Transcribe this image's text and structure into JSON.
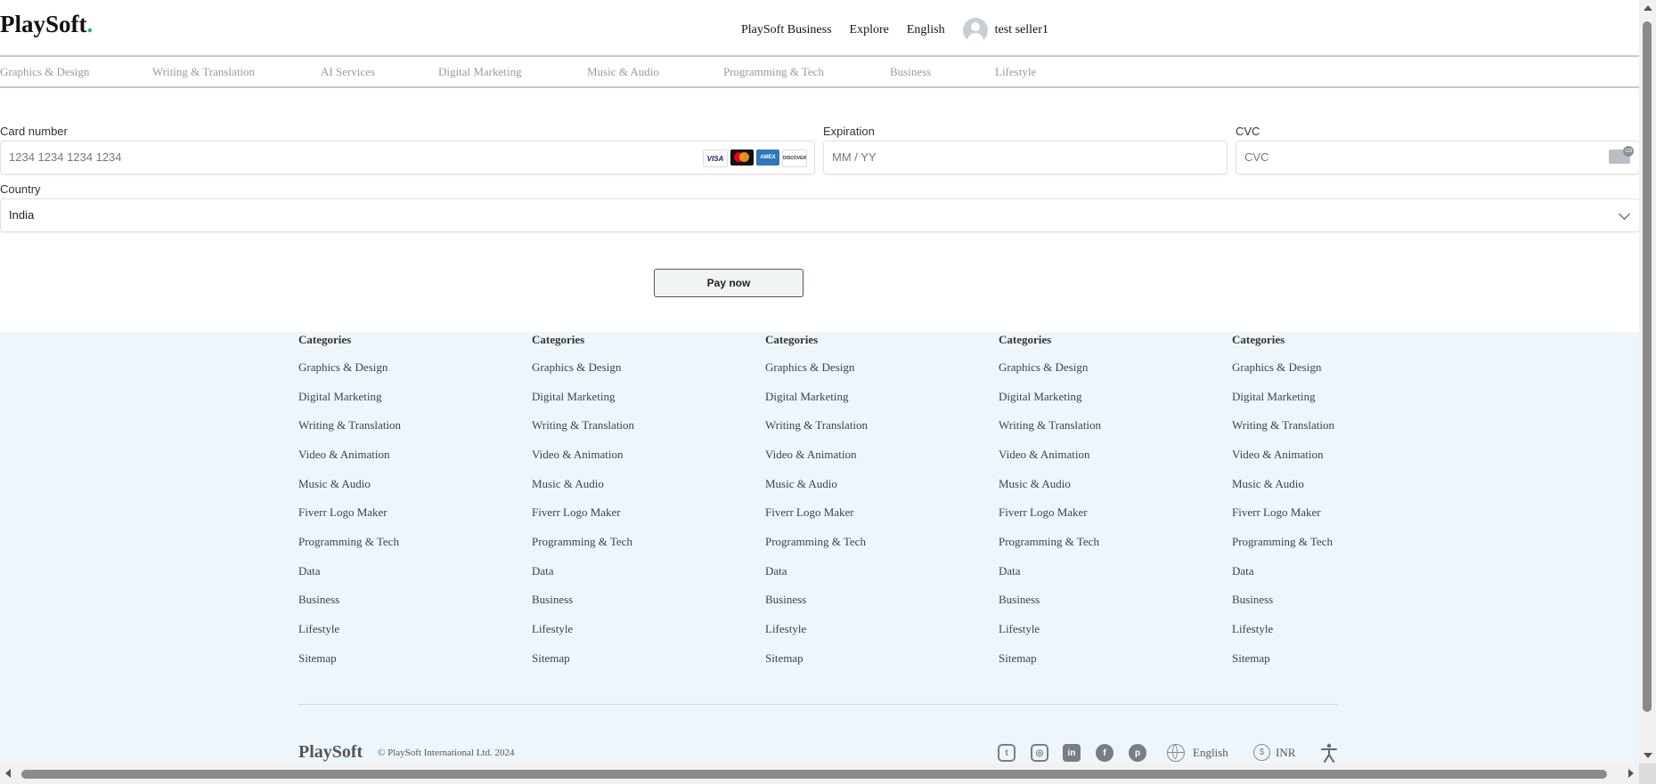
{
  "header": {
    "logo": "PlaySoft",
    "logo_dot": ".",
    "nav": {
      "business": "PlaySoft Business",
      "explore": "Explore",
      "language": "English",
      "username": "test seller1"
    },
    "categories": [
      "Graphics & Design",
      "Writing & Translation",
      "AI Services",
      "Digital Marketing",
      "Music & Audio",
      "Programming & Tech",
      "Business",
      "Lifestyle"
    ]
  },
  "payment": {
    "card_number_label": "Card number",
    "card_number_placeholder": "1234 1234 1234 1234",
    "card_brands": [
      "VISA",
      "Mastercard",
      "AMEX",
      "DISCOVER"
    ],
    "expiration_label": "Expiration",
    "expiration_placeholder": "MM / YY",
    "cvc_label": "CVC",
    "cvc_placeholder": "CVC",
    "country_label": "Country",
    "country_value": "India",
    "pay_button": "Pay now"
  },
  "footer": {
    "columns": [
      {
        "title": "Categories",
        "links": [
          "Graphics & Design",
          "Digital Marketing",
          "Writing & Translation",
          "Video & Animation",
          "Music & Audio",
          "Fiverr Logo Maker",
          "Programming & Tech",
          "Data",
          "Business",
          "Lifestyle",
          "Sitemap"
        ]
      },
      {
        "title": "Categories",
        "links": [
          "Graphics & Design",
          "Digital Marketing",
          "Writing & Translation",
          "Video & Animation",
          "Music & Audio",
          "Fiverr Logo Maker",
          "Programming & Tech",
          "Data",
          "Business",
          "Lifestyle",
          "Sitemap"
        ]
      },
      {
        "title": "Categories",
        "links": [
          "Graphics & Design",
          "Digital Marketing",
          "Writing & Translation",
          "Video & Animation",
          "Music & Audio",
          "Fiverr Logo Maker",
          "Programming & Tech",
          "Data",
          "Business",
          "Lifestyle",
          "Sitemap"
        ]
      },
      {
        "title": "Categories",
        "links": [
          "Graphics & Design",
          "Digital Marketing",
          "Writing & Translation",
          "Video & Animation",
          "Music & Audio",
          "Fiverr Logo Maker",
          "Programming & Tech",
          "Data",
          "Business",
          "Lifestyle",
          "Sitemap"
        ]
      },
      {
        "title": "Categories",
        "links": [
          "Graphics & Design",
          "Digital Marketing",
          "Writing & Translation",
          "Video & Animation",
          "Music & Audio",
          "Fiverr Logo Maker",
          "Programming & Tech",
          "Data",
          "Business",
          "Lifestyle",
          "Sitemap"
        ]
      }
    ],
    "brand": "PlaySoft",
    "copyright": "© PlaySoft International Ltd. 2024",
    "social_icons": [
      "twitter-icon",
      "instagram-icon",
      "linkedin-icon",
      "facebook-icon",
      "pinterest-icon"
    ],
    "language": "English",
    "currency": "INR",
    "currency_symbol": "$"
  },
  "colors": {
    "brand_dot": "#1dbf73",
    "footer_bg": "#eef6fc"
  }
}
